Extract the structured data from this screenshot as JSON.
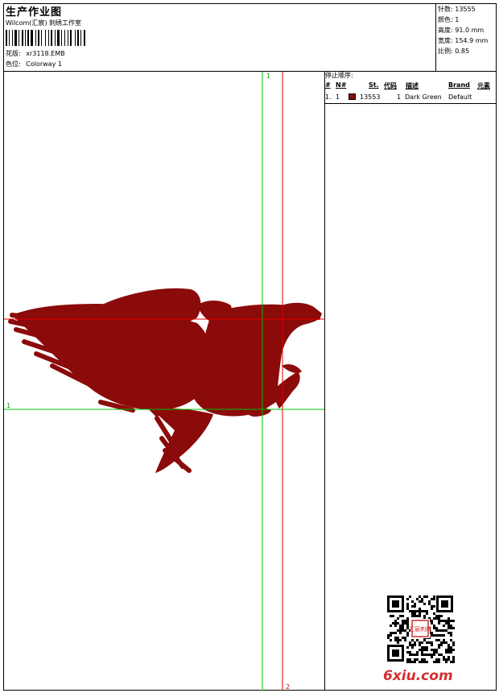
{
  "header": {
    "title": "生产作业图",
    "company": "Wilcom(汇宸) 刺绣工作室",
    "design_label": "花版:",
    "design_value": "xr3118.EMB",
    "colorway_label": "色位:",
    "colorway_value": "Colorway 1"
  },
  "stats": {
    "stitches_label": "针数:",
    "stitches_value": "13555",
    "colors_label": "颜色:",
    "colors_value": "1",
    "height_label": "高度:",
    "height_value": "91.0 mm",
    "width_label": "宽度:",
    "width_value": "154.9 mm",
    "scale_label": "比例:",
    "scale_value": "0.85"
  },
  "stop_sequence": {
    "title": "停止顺序:",
    "columns": [
      "#",
      "N#",
      "St.",
      "代码",
      "描述",
      "Brand",
      "元素"
    ],
    "rows": [
      {
        "num": "1.",
        "n": "1",
        "stitches": "13553",
        "code": "1",
        "desc": "Dark Green",
        "brand": "Default",
        "swatch_color": "#8b0a0a"
      }
    ]
  },
  "canvas": {
    "marker_v1": "1",
    "marker_v2": "2",
    "marker_h1": "1",
    "design_color": "#8b0a0a",
    "guide_green": "#00c000",
    "guide_red": "#e00000"
  },
  "watermark": {
    "text": "6xiu.com",
    "color": "#d32f2f",
    "seal_text": "汇宸刺绣"
  }
}
